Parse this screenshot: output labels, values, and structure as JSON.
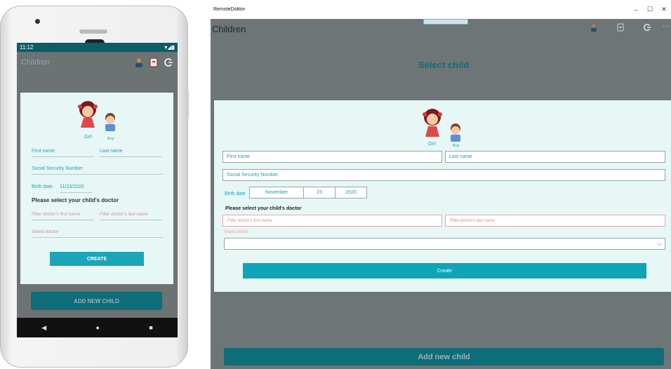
{
  "phone": {
    "status_time": "11:12",
    "app_title": "Children",
    "girl_label": "Girl",
    "boy_label": "Boy",
    "first_name_placeholder": "First name",
    "last_name_placeholder": "Last name",
    "ssn_placeholder": "Social Security Number",
    "birth_date_label": "Birth date",
    "birth_date_value": "11/23/2020",
    "doctor_heading": "Please select your child's doctor",
    "filter_first_placeholder": "Filter doctor's first name",
    "filter_last_placeholder": "Filter doctor's last name",
    "select_doctor_placeholder": "Select doctor",
    "create_label": "CREATE",
    "add_new_label": "ADD NEW CHILD"
  },
  "window": {
    "window_title": "RemoteDoktor",
    "minimize": "–",
    "maximize": "☐",
    "close": "✕",
    "app_title": "Children",
    "more": "···",
    "page_heading": "Select child",
    "girl_label": "Girl",
    "boy_label": "Boy",
    "first_name_placeholder": "First name",
    "last_name_placeholder": "Last name",
    "ssn_placeholder": "Social Security Number",
    "birth_date_label": "Birth date",
    "birth_month": "November",
    "birth_day": "23",
    "birth_year": "2020",
    "doctor_heading": "Please select your child's doctor",
    "filter_first_placeholder": "Filter doctor's first name",
    "filter_last_placeholder": "Filter doctor's last name",
    "select_doctor_label": "Select doctor",
    "create_label": "Create",
    "add_new_label": "Add new child"
  },
  "colors": {
    "accent": "#1aa5b8",
    "card_bg": "#e6f7f5",
    "backdrop": "#6d7576",
    "dark_button": "#0f6c79"
  },
  "icons": [
    "doctor-icon",
    "document-icon",
    "logout-icon",
    "girl-avatar-icon",
    "boy-avatar-icon"
  ]
}
